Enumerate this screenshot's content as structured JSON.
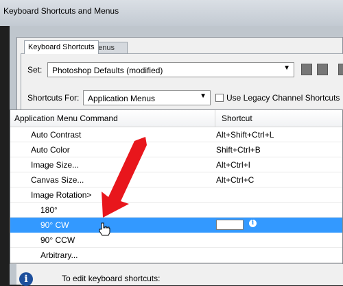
{
  "window": {
    "title": "Keyboard Shortcuts and Menus"
  },
  "tabs": [
    {
      "label": "Keyboard Shortcuts",
      "active": true
    },
    {
      "label": "Menus",
      "active": false
    }
  ],
  "set": {
    "label": "Set:",
    "value": "Photoshop Defaults (modified)"
  },
  "shortcuts_for": {
    "label": "Shortcuts For:",
    "value": "Application Menus",
    "legacy_checkbox_label": "Use Legacy Channel Shortcuts",
    "legacy_checked": false
  },
  "table": {
    "headers": {
      "command": "Application Menu Command",
      "shortcut": "Shortcut"
    },
    "rows": [
      {
        "command": "Auto Contrast",
        "shortcut": "Alt+Shift+Ctrl+L",
        "indent": 1,
        "selected": false
      },
      {
        "command": "Auto Color",
        "shortcut": "Shift+Ctrl+B",
        "indent": 1,
        "selected": false
      },
      {
        "command": "Image Size...",
        "shortcut": "Alt+Ctrl+I",
        "indent": 1,
        "selected": false
      },
      {
        "command": "Canvas Size...",
        "shortcut": "Alt+Ctrl+C",
        "indent": 1,
        "selected": false
      },
      {
        "command": "Image Rotation>",
        "shortcut": "",
        "indent": 1,
        "selected": false
      },
      {
        "command": "180°",
        "shortcut": "",
        "indent": 2,
        "selected": false
      },
      {
        "command": "90° CW",
        "shortcut": "",
        "indent": 2,
        "selected": true
      },
      {
        "command": "90° CCW",
        "shortcut": "",
        "indent": 2,
        "selected": false
      },
      {
        "command": "Arbitrary...",
        "shortcut": "",
        "indent": 2,
        "selected": false
      }
    ]
  },
  "info": {
    "text": "To edit keyboard shortcuts:"
  },
  "colors": {
    "selection": "#3399ff",
    "arrow": "#e8161c",
    "info_icon": "#1d4f9c"
  },
  "icons": [
    "save-set-icon",
    "save-set-as-icon",
    "delete-set-icon",
    "info-icon",
    "hand-cursor-icon"
  ]
}
